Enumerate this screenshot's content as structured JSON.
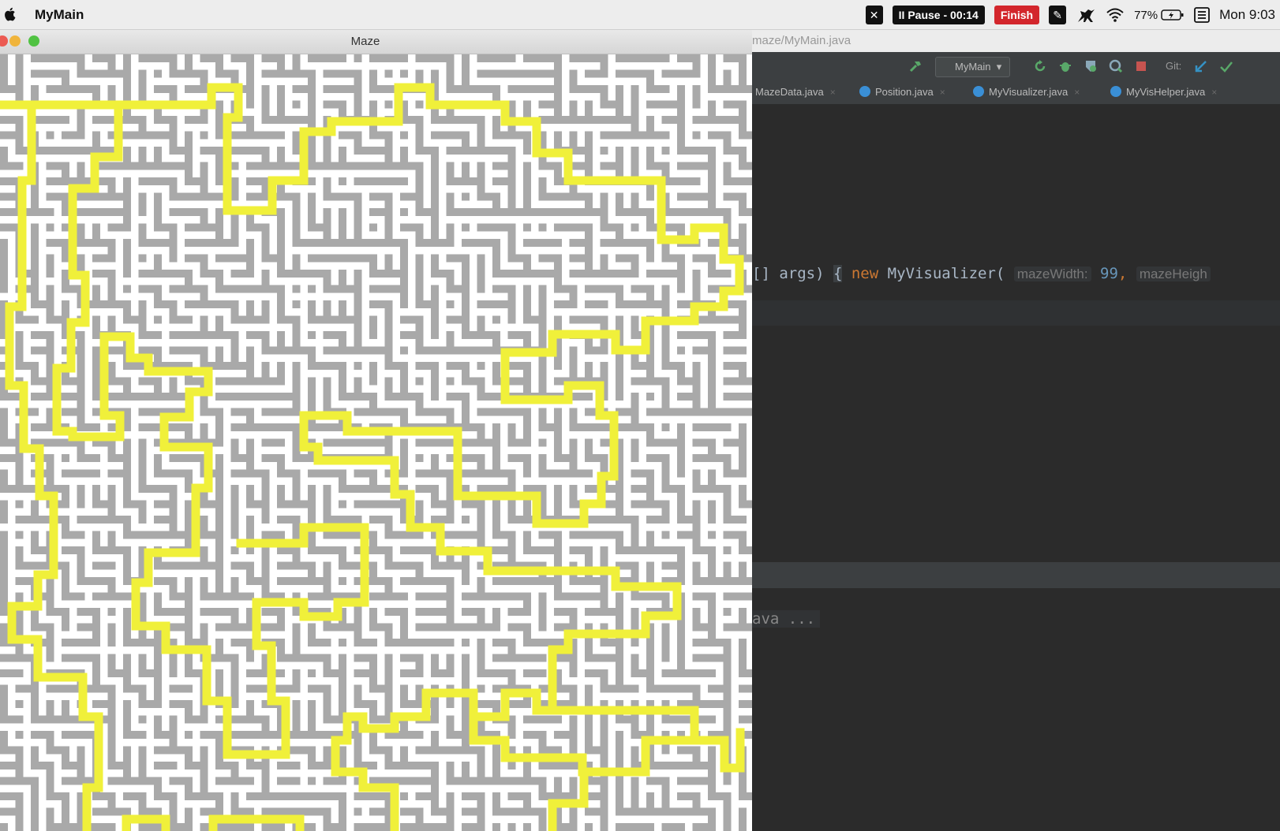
{
  "menubar": {
    "app_name": "MyMain",
    "close_label": "✕",
    "pause_label": "II Pause - 00:14",
    "finish_label": "Finish",
    "pen_label": "✎",
    "battery": "77%",
    "clock": "Mon 9:03"
  },
  "maze_window": {
    "title": "Maze",
    "path_color": "#f0f03a",
    "wall_color": "#a9a9a9",
    "floor_color": "#ffffff",
    "maze_size": 99
  },
  "ide": {
    "file_path": "maze/MyMain.java",
    "run_config": "MyMain",
    "git_label": "Git:",
    "tabs": [
      {
        "label": "MazeData.java"
      },
      {
        "label": "Position.java"
      },
      {
        "label": "MyVisualizer.java"
      },
      {
        "label": "MyVisHelper.java"
      }
    ],
    "code": {
      "prefix": "[] args) ",
      "brace": "{",
      "keyword": "new",
      "call": "MyVisualizer(",
      "hint1": "mazeWidth:",
      "num1": "99",
      "comma": ",",
      "hint2": "mazeHeigh"
    },
    "console": "ava ..."
  }
}
